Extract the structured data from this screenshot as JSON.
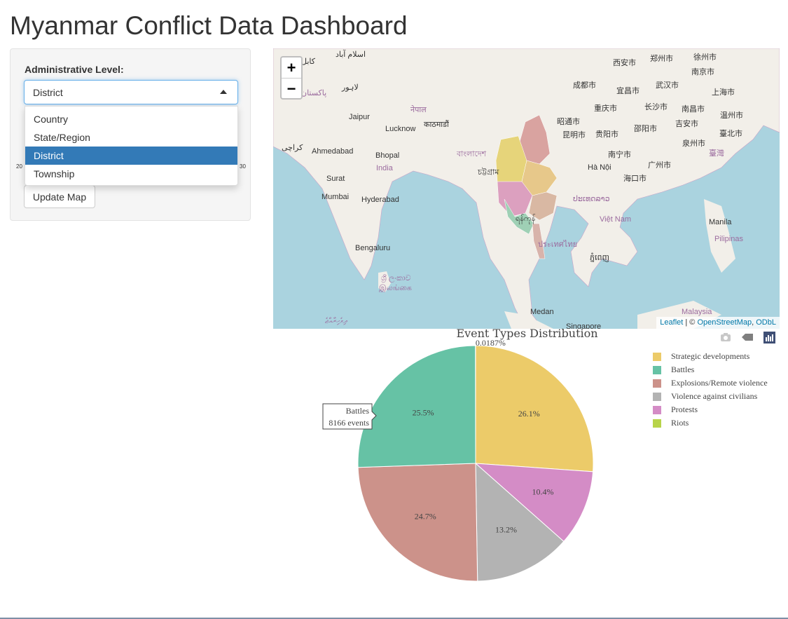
{
  "page": {
    "title": "Myanmar Conflict Data Dashboard"
  },
  "sidebar": {
    "admin_label": "Administrative Level:",
    "selected": "District",
    "options": [
      "Country",
      "State/Region",
      "District",
      "Township"
    ],
    "slider_min_label": "20",
    "slider_max_label": "30",
    "update_button": "Update Map"
  },
  "map": {
    "zoom_in": "+",
    "zoom_out": "−",
    "attribution_leaflet": "Leaflet",
    "attribution_sep": " | © ",
    "attribution_osm": "OpenStreetMap",
    "attribution_odbl": "ODbL",
    "labels": {
      "xian": "西安市",
      "zhengzhou": "郑州市",
      "xuzhou": "徐州市",
      "nanjing": "南京市",
      "chengdu": "成都市",
      "yichang": "宜昌市",
      "wuhan": "武汉市",
      "shanghai": "上海市",
      "chongqing": "重庆市",
      "changsha": "长沙市",
      "nanchang": "南昌市",
      "wenzhou": "温州市",
      "zhaotong": "昭通市",
      "kunming": "昆明市",
      "guiyang": "贵阳市",
      "shaoyang": "邵阳市",
      "jian": "吉安市",
      "taipei": "臺北市",
      "quanzhou": "泉州市",
      "taiwan": "臺灣",
      "nanning": "南宁市",
      "guangzhou": "广州市",
      "hanoi": "Hà Nội",
      "haikou": "海口市",
      "jaipur": "Jaipur",
      "lucknow": "Lucknow",
      "kathmandu": "काठमाडौं",
      "nepal": "नेपाल",
      "ahmedabad": "Ahmedabad",
      "bhopal": "Bhopal",
      "india": "India",
      "karachi": "کراچی",
      "bangladesh": "বাংলাদেশ",
      "chittagong": "চট্টগ্রাম",
      "surat": "Surat",
      "mumbai": "Mumbai",
      "hyderabad": "Hyderabad",
      "laos": "ປະເທດລາວ",
      "vietnam": "Việt Nam",
      "thailand": "ประเทศไทย",
      "yangon": "ရန်ကုန်",
      "bengaluru": "Bengaluru",
      "phnompenh": "ភ្នំពេញ",
      "srilanka1": "ශ්‍රී ලංකාව",
      "srilanka2": "இலங்கை",
      "manila": "Manila",
      "pilipinas": "Pilipinas",
      "medan": "Medan",
      "malaysia": "Malaysia",
      "singapore": "Singapore",
      "maldives": "ދިވެހިރާއްޖެ",
      "islamabad": "اسلام آباد",
      "kabul": "کابل",
      "lahore": "لاہور",
      "pakistan": "پاکستان"
    }
  },
  "colors": {
    "accent": "#337ab7",
    "strategic": "#eccb69",
    "battles": "#66c2a5",
    "explosions": "#cc928a",
    "violence": "#b3b3b3",
    "protests": "#d48cc6",
    "riots": "#b8d44a"
  },
  "chart_data": {
    "type": "pie",
    "title": "Event Types Distribution",
    "labels": [
      "Strategic developments",
      "Protests",
      "Violence against civilians",
      "Explosions/Remote violence",
      "Battles",
      "Riots"
    ],
    "legend_order": [
      "Strategic developments",
      "Battles",
      "Explosions/Remote violence",
      "Violence against civilians",
      "Protests",
      "Riots"
    ],
    "values": [
      26.1,
      10.4,
      13.2,
      24.7,
      25.5,
      0.0187
    ],
    "value_labels": [
      "26.1%",
      "10.4%",
      "13.2%",
      "24.7%",
      "25.5%",
      "0.0187%"
    ],
    "unit": "percent",
    "legend_position": "top-right",
    "tooltip": {
      "label": "Battles",
      "value": "8166 events"
    }
  },
  "icons": [
    "camera-icon",
    "zoom-icon",
    "plotly-logo-icon",
    "caret-up-icon"
  ]
}
